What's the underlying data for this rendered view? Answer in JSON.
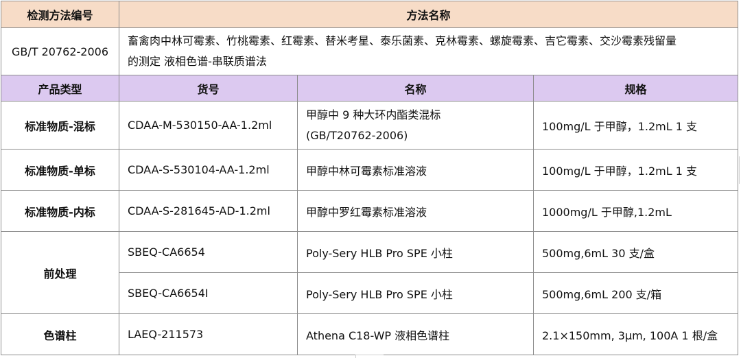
{
  "method_header": {
    "col1": "检测方法编号",
    "col2": "方法名称"
  },
  "method_row": {
    "code": "GB/T 20762-2006",
    "name_line1": "畜禽肉中林可霉素、竹桃霉素、红霉素、替米考星、泰乐菌素、克林霉素、螺旋霉素、吉它霉素、交沙霉素残留量",
    "name_line2": "的测定 液相色谱-串联质谱法"
  },
  "product_header": {
    "type": "产品类型",
    "sku": "货号",
    "name": "名称",
    "spec": "规格"
  },
  "rows": [
    {
      "type": "标准物质-混标",
      "sku": "CDAA-M-530150-AA-1.2ml",
      "name_line1": "甲醇中 9 种大环内酯类混标",
      "name_line2": "(GB/T20762-2006)",
      "spec": "100mg/L 于甲醇，1.2mL 1 支"
    },
    {
      "type": "标准物质-单标",
      "sku": "CDAA-S-530104-AA-1.2ml",
      "name": "甲醇中林可霉素标准溶液",
      "spec": "100mg/L 于甲醇，1.2mL 1 支"
    },
    {
      "type": "标准物质-内标",
      "sku": "CDAA-S-281645-AD-1.2ml",
      "name": "甲醇中罗红霉素标准溶液",
      "spec": "1000mg/L 于甲醇,1.2mL"
    },
    {
      "type": "前处理",
      "sku": "SBEQ-CA6654",
      "name": "Poly-Sery HLB Pro SPE  小柱",
      "spec": "500mg,6mL 30 支/盒"
    },
    {
      "sku": "SBEQ-CA6654I",
      "name": "Poly-Sery HLB Pro SPE  小柱",
      "spec": "500mg,6mL 200 支/箱"
    },
    {
      "type": "色谱柱",
      "sku": "LAEQ-211573",
      "name": "Athena C18-WP  液相色谱柱",
      "spec": "2.1×150mm, 3μm, 100A 1 根/盒"
    }
  ]
}
